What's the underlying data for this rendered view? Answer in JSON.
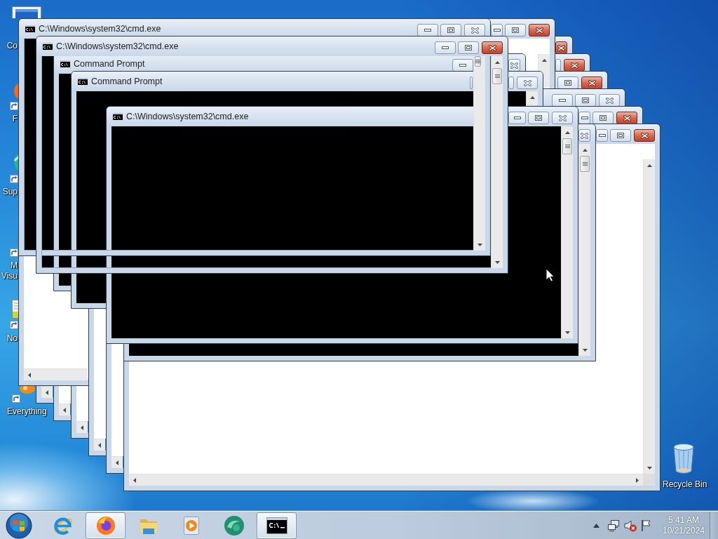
{
  "desktop_icons": [
    {
      "kind": "computer",
      "lines": [
        "Co"
      ]
    },
    {
      "kind": "fox",
      "lines": [
        "F"
      ]
    },
    {
      "kind": "sup",
      "lines": [
        "Sup"
      ]
    },
    {
      "kind": "visual",
      "lines": [
        "M",
        "Visu"
      ]
    },
    {
      "kind": "notepad",
      "lines": [
        "No"
      ]
    },
    {
      "kind": "everything",
      "lines": [
        "Everything"
      ]
    }
  ],
  "recycle_bin": {
    "label": "Recycle Bin"
  },
  "windows": [
    {
      "kind": "console",
      "title": "C:\\Windows\\system32\\cmd.exe",
      "active": false
    },
    {
      "kind": "console",
      "title": "C:\\Windows\\system32\\cmd.exe",
      "active": true
    },
    {
      "kind": "console",
      "title": "Command Prompt",
      "active": false
    },
    {
      "kind": "console",
      "title": "Command Prompt",
      "active": false
    },
    {
      "kind": "console",
      "title": "C:\\Windows\\system32\\cmd.exe",
      "active": false
    },
    {
      "kind": "console",
      "active": false
    },
    {
      "kind": "blank",
      "active": true
    },
    {
      "kind": "blank",
      "active": true
    },
    {
      "kind": "blank",
      "active": true
    },
    {
      "kind": "blank",
      "active": true
    },
    {
      "kind": "blank",
      "active": false
    },
    {
      "kind": "blank",
      "active": true
    },
    {
      "kind": "blank",
      "active": true
    }
  ],
  "taskbar": {
    "apps": [
      {
        "kind": "ie",
        "running": false
      },
      {
        "kind": "firefox",
        "running": true
      },
      {
        "kind": "explorer",
        "running": false
      },
      {
        "kind": "media",
        "running": false
      },
      {
        "kind": "swirl",
        "running": false
      },
      {
        "kind": "console",
        "running": true
      }
    ],
    "tray": {
      "sound_muted": true
    },
    "clock": {
      "time": "5:41 AM",
      "date": "10/21/2024"
    }
  }
}
